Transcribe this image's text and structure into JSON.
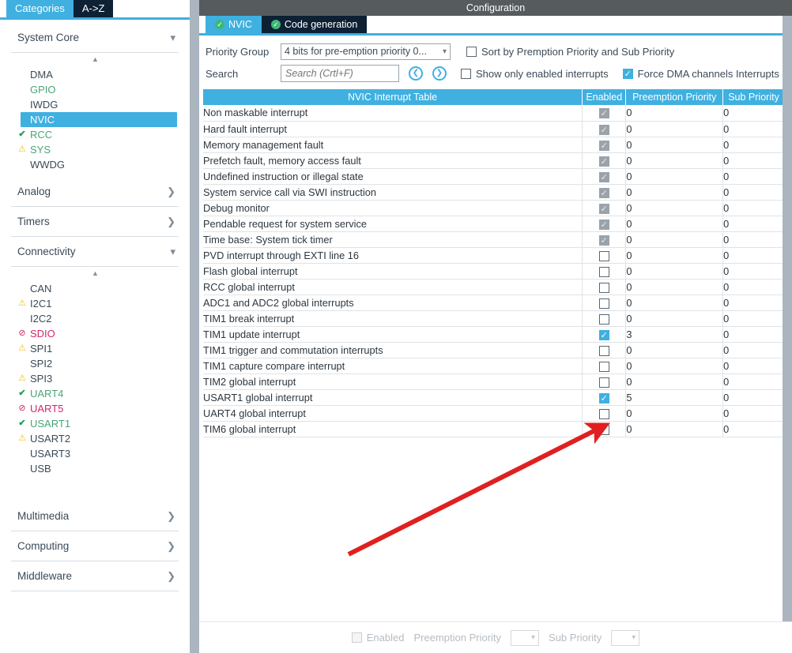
{
  "sidebar": {
    "tabs": [
      {
        "label": "Categories",
        "active": true
      },
      {
        "label": "A->Z",
        "active": false
      }
    ],
    "sections": [
      {
        "title": "System Core",
        "expanded": true,
        "chevron": "chevron-down",
        "items": [
          {
            "label": "DMA",
            "status": "none",
            "color": "dark",
            "selected": false
          },
          {
            "label": "GPIO",
            "status": "none",
            "color": "green",
            "selected": false
          },
          {
            "label": "IWDG",
            "status": "none",
            "color": "dark",
            "selected": false
          },
          {
            "label": "NVIC",
            "status": "none",
            "color": "dark",
            "selected": true
          },
          {
            "label": "RCC",
            "status": "ok",
            "color": "green",
            "selected": false
          },
          {
            "label": "SYS",
            "status": "warn",
            "color": "green",
            "selected": false
          },
          {
            "label": "WWDG",
            "status": "none",
            "color": "dark",
            "selected": false
          }
        ]
      },
      {
        "title": "Analog",
        "expanded": false,
        "chevron": "chevron-right",
        "items": []
      },
      {
        "title": "Timers",
        "expanded": false,
        "chevron": "chevron-right",
        "items": []
      },
      {
        "title": "Connectivity",
        "expanded": true,
        "chevron": "chevron-down",
        "items": [
          {
            "label": "CAN",
            "status": "none",
            "color": "dark",
            "selected": false
          },
          {
            "label": "I2C1",
            "status": "warn",
            "color": "dark",
            "selected": false
          },
          {
            "label": "I2C2",
            "status": "none",
            "color": "dark",
            "selected": false
          },
          {
            "label": "SDIO",
            "status": "err",
            "color": "pink",
            "selected": false
          },
          {
            "label": "SPI1",
            "status": "warn",
            "color": "dark",
            "selected": false
          },
          {
            "label": "SPI2",
            "status": "none",
            "color": "dark",
            "selected": false
          },
          {
            "label": "SPI3",
            "status": "warn",
            "color": "dark",
            "selected": false
          },
          {
            "label": "UART4",
            "status": "ok",
            "color": "green",
            "selected": false
          },
          {
            "label": "UART5",
            "status": "err",
            "color": "pink",
            "selected": false
          },
          {
            "label": "USART1",
            "status": "ok",
            "color": "green",
            "selected": false
          },
          {
            "label": "USART2",
            "status": "warn",
            "color": "dark",
            "selected": false
          },
          {
            "label": "USART3",
            "status": "none",
            "color": "dark",
            "selected": false
          },
          {
            "label": "USB",
            "status": "none",
            "color": "dark",
            "selected": false
          }
        ]
      },
      {
        "title": "Multimedia",
        "expanded": false,
        "chevron": "chevron-right",
        "items": []
      },
      {
        "title": "Computing",
        "expanded": false,
        "chevron": "chevron-right",
        "items": []
      },
      {
        "title": "Middleware",
        "expanded": false,
        "chevron": "chevron-right",
        "items": []
      }
    ]
  },
  "panel": {
    "title": "Configuration",
    "tabs": [
      {
        "label": "NVIC",
        "active": true,
        "icon": "check-circle-icon"
      },
      {
        "label": "Code generation",
        "active": false,
        "icon": "check-circle-icon"
      }
    ],
    "priority_group": {
      "label": "Priority Group",
      "value": "4 bits for pre-emption priority 0..."
    },
    "search": {
      "label": "Search",
      "value": "",
      "placeholder": "Search (Crtl+F)",
      "prev_icon": "chevron-left-circle-icon",
      "next_icon": "chevron-right-circle-icon"
    },
    "options": [
      {
        "label": "Sort by Premption Priority and Sub Priority",
        "checked": false
      },
      {
        "label": "Show only enabled interrupts",
        "checked": false
      },
      {
        "label": "Force DMA channels Interrupts",
        "checked": true
      }
    ],
    "table": {
      "headers": [
        "NVIC Interrupt Table",
        "Enabled",
        "Preemption Priority",
        "Sub Priority"
      ],
      "rows": [
        {
          "name": "Non maskable interrupt",
          "enabled": true,
          "locked": true,
          "pre": "0",
          "sub": "0",
          "dim": true
        },
        {
          "name": "Hard fault interrupt",
          "enabled": true,
          "locked": true,
          "pre": "0",
          "sub": "0",
          "dim": true
        },
        {
          "name": "Memory management fault",
          "enabled": true,
          "locked": true,
          "pre": "0",
          "sub": "0",
          "dim": false
        },
        {
          "name": "Prefetch fault, memory access fault",
          "enabled": true,
          "locked": true,
          "pre": "0",
          "sub": "0",
          "dim": false
        },
        {
          "name": "Undefined instruction or illegal state",
          "enabled": true,
          "locked": true,
          "pre": "0",
          "sub": "0",
          "dim": false
        },
        {
          "name": "System service call via SWI instruction",
          "enabled": true,
          "locked": true,
          "pre": "0",
          "sub": "0",
          "dim": false
        },
        {
          "name": "Debug monitor",
          "enabled": true,
          "locked": true,
          "pre": "0",
          "sub": "0",
          "dim": false
        },
        {
          "name": "Pendable request for system service",
          "enabled": true,
          "locked": true,
          "pre": "0",
          "sub": "0",
          "dim": false
        },
        {
          "name": "Time base: System tick timer",
          "enabled": true,
          "locked": true,
          "pre": "0",
          "sub": "0",
          "dim": false
        },
        {
          "name": "PVD interrupt through EXTI line 16",
          "enabled": false,
          "locked": false,
          "pre": "0",
          "sub": "0",
          "dim": false
        },
        {
          "name": "Flash global interrupt",
          "enabled": false,
          "locked": false,
          "pre": "0",
          "sub": "0",
          "dim": false
        },
        {
          "name": "RCC global interrupt",
          "enabled": false,
          "locked": false,
          "pre": "0",
          "sub": "0",
          "dim": false
        },
        {
          "name": "ADC1 and ADC2 global interrupts",
          "enabled": false,
          "locked": false,
          "pre": "0",
          "sub": "0",
          "dim": false
        },
        {
          "name": "TIM1 break interrupt",
          "enabled": false,
          "locked": false,
          "pre": "0",
          "sub": "0",
          "dim": false
        },
        {
          "name": "TIM1 update interrupt",
          "enabled": true,
          "locked": false,
          "pre": "3",
          "sub": "0",
          "dim": false
        },
        {
          "name": "TIM1 trigger and commutation interrupts",
          "enabled": false,
          "locked": false,
          "pre": "0",
          "sub": "0",
          "dim": false
        },
        {
          "name": "TIM1 capture compare interrupt",
          "enabled": false,
          "locked": false,
          "pre": "0",
          "sub": "0",
          "dim": false
        },
        {
          "name": "TIM2 global interrupt",
          "enabled": false,
          "locked": false,
          "pre": "0",
          "sub": "0",
          "dim": false
        },
        {
          "name": "USART1 global interrupt",
          "enabled": true,
          "locked": false,
          "pre": "5",
          "sub": "0",
          "dim": false
        },
        {
          "name": "UART4 global interrupt",
          "enabled": false,
          "locked": false,
          "pre": "0",
          "sub": "0",
          "dim": false
        },
        {
          "name": "TIM6 global interrupt",
          "enabled": false,
          "locked": false,
          "pre": "0",
          "sub": "0",
          "dim": false
        }
      ]
    },
    "footer": {
      "enabled_label": "Enabled",
      "enabled_checked": false,
      "preemption_label": "Preemption Priority",
      "preemption_value": "",
      "sub_label": "Sub Priority",
      "sub_value": ""
    }
  },
  "annotation": {
    "arrow_color": "#e02020",
    "points_to": "USART1 global interrupt enabled checkbox"
  },
  "colors": {
    "accent": "#3fb0e0",
    "tab_dark": "#0d2034",
    "titlebar": "#565b5e",
    "ok": "#1f9d55",
    "warn": "#f2c01e",
    "error": "#d6246e",
    "green_label": "#4aa578"
  }
}
